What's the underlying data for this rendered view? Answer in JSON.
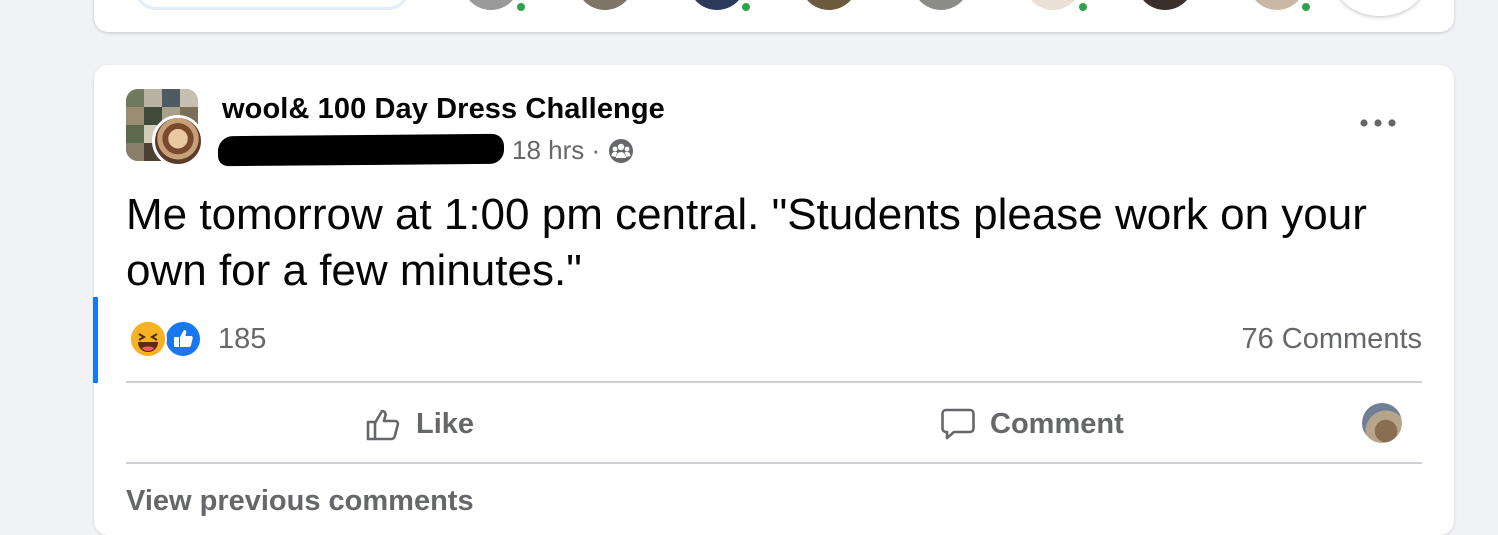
{
  "stories": {
    "circles": [
      {
        "color": "#9a9a9a",
        "online": true
      },
      {
        "color": "#7d7568",
        "online": false
      },
      {
        "color": "#2e3a5c",
        "online": true
      },
      {
        "color": "#6b5a3e",
        "online": false
      },
      {
        "color": "#8d8d88",
        "online": false
      },
      {
        "color": "#e9e1d6",
        "online": true
      },
      {
        "color": "#3a2f2a",
        "online": false
      },
      {
        "color": "#c9b9a4",
        "online": true
      }
    ]
  },
  "post": {
    "group_name": "wool& 100 Day Dress Challenge",
    "time": "18 hrs · ",
    "privacy_icon": "group-privacy-icon",
    "more_icon": "more-options-icon",
    "text": "Me tomorrow at 1:00 pm central. \"Students please work on your own for a few minutes.\"",
    "reactions": {
      "types": [
        "haha",
        "like"
      ],
      "count": "185"
    },
    "comments_count": "76 Comments",
    "actions": {
      "like_label": "Like",
      "comment_label": "Comment"
    },
    "view_previous": "View previous comments"
  },
  "colors": {
    "background": "#f0f2f5",
    "accent": "#1877f2",
    "secondary_text": "#65676b",
    "online": "#31a24c"
  }
}
